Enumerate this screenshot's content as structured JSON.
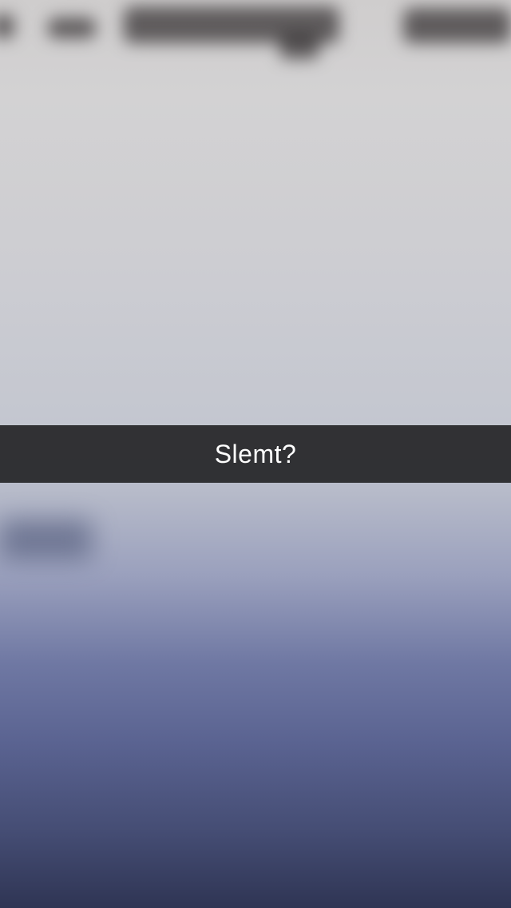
{
  "caption": {
    "text": "Slemt?"
  },
  "colors": {
    "top_background": "#d2d1d2",
    "bottom_background": "#2f3554",
    "caption_bar": "#262628",
    "caption_text": "#ffffff"
  }
}
